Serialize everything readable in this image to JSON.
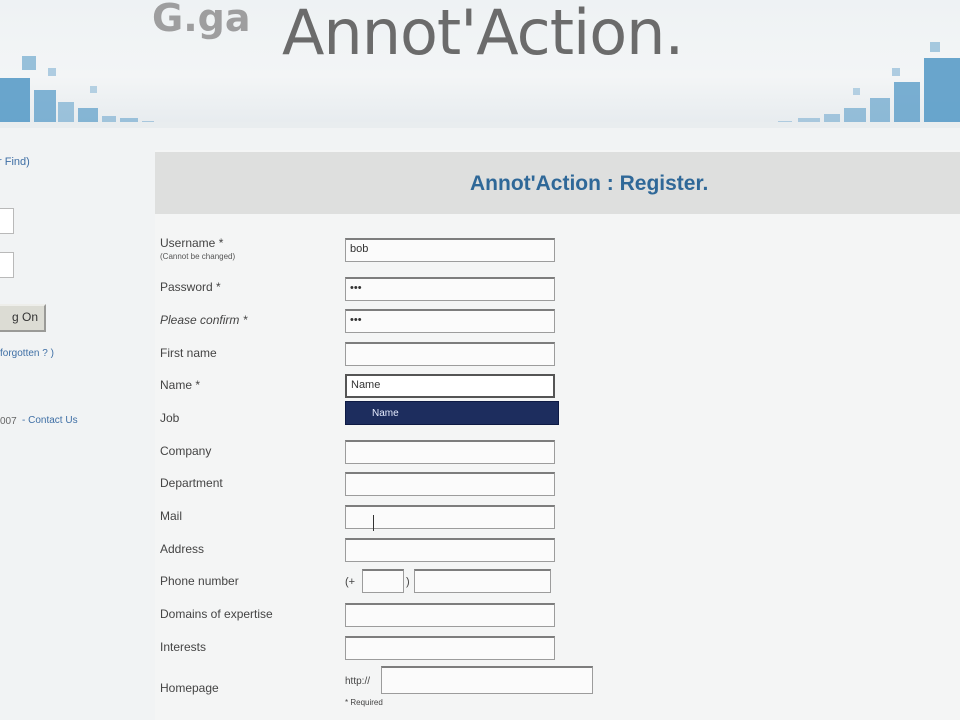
{
  "header": {
    "brand_prefix": "G.ga",
    "brand": "Annot'Action."
  },
  "sidebar": {
    "link_top": "r Find)",
    "logon_button": "g On",
    "forgotten_link": "forgotten ? )",
    "footer_year": "007",
    "contact_link": "- Contact Us"
  },
  "page": {
    "title": "Annot'Action : Register."
  },
  "form": {
    "username_label": "Username *",
    "username_sub": "(Cannot be changed)",
    "username_value": "bob",
    "password_label": "Password *",
    "password_value": "•••",
    "confirm_label": "Please confirm *",
    "confirm_value": "•••",
    "firstname_label": "First name",
    "firstname_value": "",
    "name_label": "Name *",
    "name_value": "Name",
    "name_suggestion": "Name",
    "job_label": "Job",
    "company_label": "Company",
    "department_label": "Department",
    "mail_label": "Mail",
    "address_label": "Address",
    "phone_label": "Phone number",
    "phone_open": "(+",
    "phone_close": ")",
    "domains_label": "Domains of expertise",
    "interests_label": "Interests",
    "homepage_label": "Homepage",
    "homepage_prefix": "http://",
    "required_note": "* Required"
  },
  "colors": {
    "title": "#2f6898",
    "autocomplete_bg": "#1d2d5e",
    "banner_accent": "#5a9cc8"
  }
}
